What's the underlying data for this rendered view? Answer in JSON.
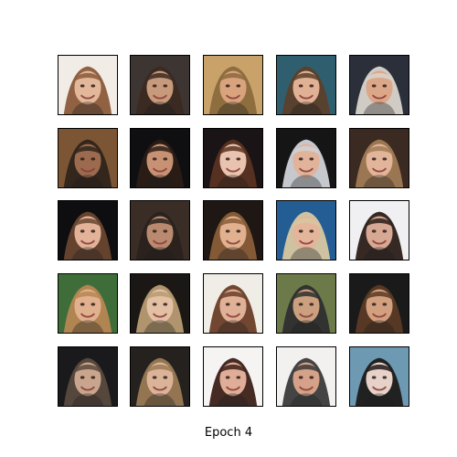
{
  "figure": {
    "caption": "Epoch 4"
  },
  "grid": {
    "rows": 5,
    "cols": 5,
    "tiles": [
      {
        "bg": "#f1ece6",
        "hair": "#8a5a3a",
        "skin": "#e2b79a"
      },
      {
        "bg": "#3c3532",
        "hair": "#3a2a22",
        "skin": "#c89a7c"
      },
      {
        "bg": "#c9a26a",
        "hair": "#8b6a3d",
        "skin": "#d9a37e"
      },
      {
        "bg": "#2f5f6f",
        "hair": "#5b3f2a",
        "skin": "#e0b194"
      },
      {
        "bg": "#2a2f3a",
        "hair": "#d9d4cc",
        "skin": "#dba788"
      },
      {
        "bg": "#7b5534",
        "hair": "#2f241c",
        "skin": "#9c6a4e"
      },
      {
        "bg": "#0f0f12",
        "hair": "#2a1d16",
        "skin": "#c79174"
      },
      {
        "bg": "#1a1416",
        "hair": "#5a3221",
        "skin": "#e9c3b0"
      },
      {
        "bg": "#151515",
        "hair": "#cfd2d7",
        "skin": "#e1b39b"
      },
      {
        "bg": "#3b2a22",
        "hair": "#a07a55",
        "skin": "#e2b49a"
      },
      {
        "bg": "#0e0e10",
        "hair": "#6a4630",
        "skin": "#e2b299"
      },
      {
        "bg": "#3a2d25",
        "hair": "#2a221e",
        "skin": "#b98a6f"
      },
      {
        "bg": "#1e1713",
        "hair": "#8a5e38",
        "skin": "#e0b08f"
      },
      {
        "bg": "#245d93",
        "hair": "#d8c7a1",
        "skin": "#e3b59b"
      },
      {
        "bg": "#f0f0f2",
        "hair": "#2b1d18",
        "skin": "#d7a893"
      },
      {
        "bg": "#3f6d3a",
        "hair": "#b78752",
        "skin": "#e1b08e"
      },
      {
        "bg": "#1b1714",
        "hair": "#b79b72",
        "skin": "#e3bfa4"
      },
      {
        "bg": "#f0ece6",
        "hair": "#6a3e27",
        "skin": "#e0b097"
      },
      {
        "bg": "#6c7a4a",
        "hair": "#2f2f2f",
        "skin": "#caa07f"
      },
      {
        "bg": "#1a1a1a",
        "hair": "#5a3a25",
        "skin": "#d2a07f"
      },
      {
        "bg": "#1a1a1c",
        "hair": "#5a4a3e",
        "skin": "#caa58e"
      },
      {
        "bg": "#24211e",
        "hair": "#9b7a55",
        "skin": "#dbb399"
      },
      {
        "bg": "#f5f4f3",
        "hair": "#3b2018",
        "skin": "#e0ae98"
      },
      {
        "bg": "#f2f1ef",
        "hair": "#3a3a3a",
        "skin": "#d5a188"
      },
      {
        "bg": "#6d99b3",
        "hair": "#1f1a1a",
        "skin": "#e6d2c8"
      }
    ]
  }
}
